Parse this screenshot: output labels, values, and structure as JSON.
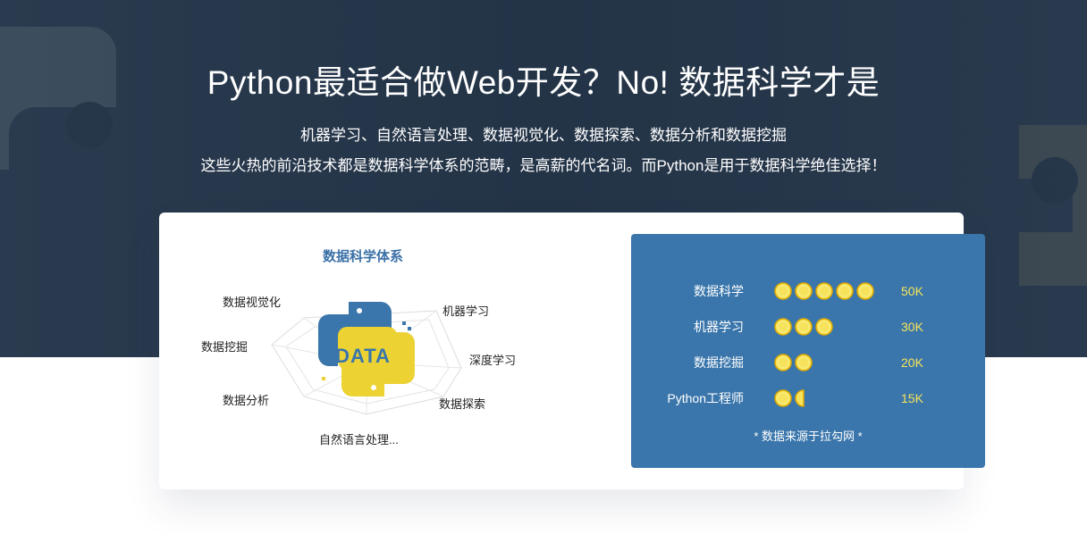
{
  "hero": {
    "headline": "Python最适合做Web开发？No! 数据科学才是",
    "sub_line_1": "机器学习、自然语言处理、数据视觉化、数据探索、数据分析和数据挖掘",
    "sub_line_2": "这些火热的前沿技术都是数据科学体系的范畴，是高薪的代名词。而Python是用于数据科学绝佳选择！"
  },
  "system": {
    "title": "数据科学体系",
    "logo_text": "DATA",
    "labels": [
      "数据视觉化",
      "机器学习",
      "数据挖掘",
      "深度学习",
      "数据分析",
      "数据探索",
      "自然语言处理..."
    ]
  },
  "salaries": {
    "rows": [
      {
        "label": "数据科学",
        "rating": 5,
        "value": "50K"
      },
      {
        "label": "机器学习",
        "rating": 3,
        "value": "30K"
      },
      {
        "label": "数据挖掘",
        "rating": 2,
        "value": "20K"
      },
      {
        "label": "Python工程师",
        "rating": 1.5,
        "value": "15K"
      }
    ],
    "source_note": "* 数据来源于拉勾网 *"
  },
  "colors": {
    "hero_bg": "#26364a",
    "panel_bg": "#3a76ab",
    "title_blue": "#3a70a6",
    "coin_yellow": "#f6e35b",
    "logo_yellow": "#ecd233",
    "logo_blue": "#3a76ab"
  }
}
